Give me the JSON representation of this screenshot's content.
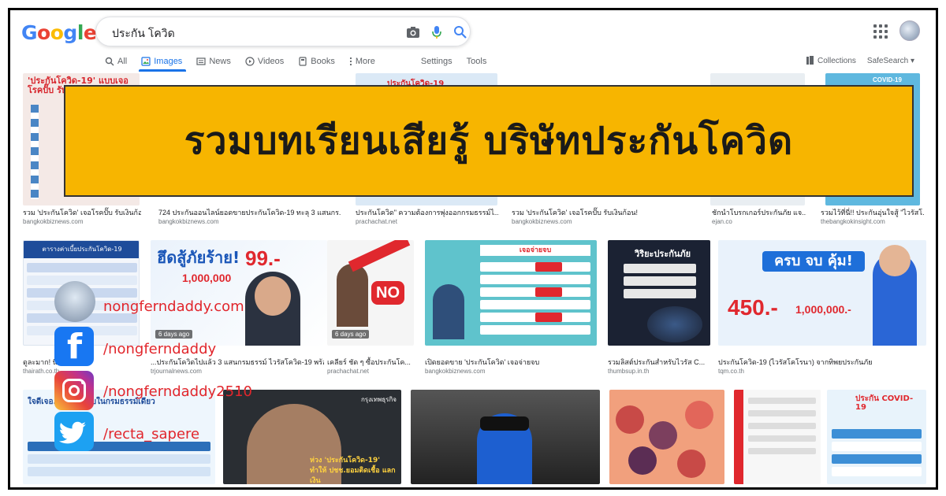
{
  "header": {
    "logo": "Google",
    "search_query": "ประกัน โควิด"
  },
  "tabs": [
    {
      "label": "All",
      "icon": "search-icon"
    },
    {
      "label": "Images",
      "icon": "image-icon"
    },
    {
      "label": "News",
      "icon": "news-icon"
    },
    {
      "label": "Videos",
      "icon": "video-icon"
    },
    {
      "label": "Books",
      "icon": "book-icon"
    },
    {
      "label": "More",
      "icon": "more-vert-icon"
    },
    {
      "label": "Settings"
    },
    {
      "label": "Tools"
    }
  ],
  "toolbar_right": {
    "collections": "Collections",
    "safesearch": "SafeSearch"
  },
  "banner": {
    "text": "รวมบทเรียนเสียรู้ บริษัทประกันโควิด"
  },
  "row1": [
    {
      "caption": "รวม 'ประกันโควิด' เจอโรคปั๊บ รับเงินก้อ...",
      "source": "bangkokbiznews.com",
      "thumb_text": "'ประกันโควิด-19' แบบเจอโรคปั๊บ รับเงินก้อน"
    },
    {
      "caption": "724 ประกันออนไลน์ยอดขายประกันโควิด-19 ทะลุ 3 แสนกร...",
      "source": "bangkokbiznews.com"
    },
    {
      "caption": "ประกันโควิด\" ความต้องการพุ่งออกกรมธรรม์ไ...",
      "source": "prachachat.net",
      "thumb_text": "ประกันโควิด-19"
    },
    {
      "caption": "รวม 'ประกันโควิด' เจอโรคปั๊บ รับเงินก้อน!",
      "source": "bangkokbiznews.com"
    },
    {
      "caption": "ชักนำโบรกเกอร์ประกันภัย แจ...",
      "source": "ejan.co"
    },
    {
      "caption": "รวมไว้ที่นี่!! ประกันอุ่นใจสู้ \"ไวรัสโ...",
      "source": "thebangkokinsight.com",
      "thumb_text": "COVID-19"
    }
  ],
  "row2": [
    {
      "caption": "ดูละมาก! นี่...",
      "source": "thairath.co.th",
      "thumb_text": "ตารางค่าเบี้ยประกันโควิด-19"
    },
    {
      "caption": "...ประกันโควิดไปแล้ว 3 แสนกรมธรรม์ ไวรัสโควิด-19 พร้อม...",
      "source": "trjournalnews.com",
      "thumb_text": "ฮึดสู้ภัยร้าย!",
      "price": "99.-",
      "cover": "1,000,000",
      "days": "6 days ago"
    },
    {
      "caption": "เคลียร์ ชัด ๆ ซื้อประกันโค...",
      "source": "prachachat.net",
      "thumb_text": "NO",
      "days": "6 days ago"
    },
    {
      "caption": "เปิดยอดขาย 'ประกันโควิด' เจอจ่ายจบ",
      "source": "bangkokbiznews.com",
      "thumb_text": "เจอจ่ายจบ"
    },
    {
      "caption": "รวมลิสต์ประกันสำหรับไวรัส C...",
      "source": "thumbsup.in.th",
      "thumb_text": "วิริยะประกันภัย"
    },
    {
      "caption": "ประกันโควิด-19 (ไวรัสโคโรนา) จากทิพยประกันภัย",
      "source": "tqm.co.th",
      "thumb_text": "ครบ จบ คุ้ม!",
      "price": "450.-",
      "cover": "1,000,000.-"
    }
  ],
  "row3": [
    {
      "thumb_text": "ใจดีเจอ...จริง\" ครบในกรมธรรม์เดียว"
    },
    {
      "thumb_text": "ห่วง 'ประกันโควิด-19' ทำให้ ปชช.ยอมติดเชื้อ แลกเงิน",
      "brand": "กรุงเทพธุรกิจ"
    },
    {
      "thumb_text": ""
    },
    {
      "thumb_text": ""
    },
    {
      "thumb_text": ""
    },
    {
      "thumb_text": "ประกัน COVID-19"
    }
  ],
  "social": {
    "website": "nongferndaddy.com",
    "facebook": "/nongferndaddy",
    "instagram": "/nongferndaddy2510",
    "twitter": "/recta_sapere"
  },
  "colors": {
    "banner_bg": "#f7b500",
    "social_text": "#e1262c",
    "google_blue": "#4285f4",
    "google_red": "#ea4335",
    "google_yellow": "#fbbc05",
    "google_green": "#34a853"
  }
}
